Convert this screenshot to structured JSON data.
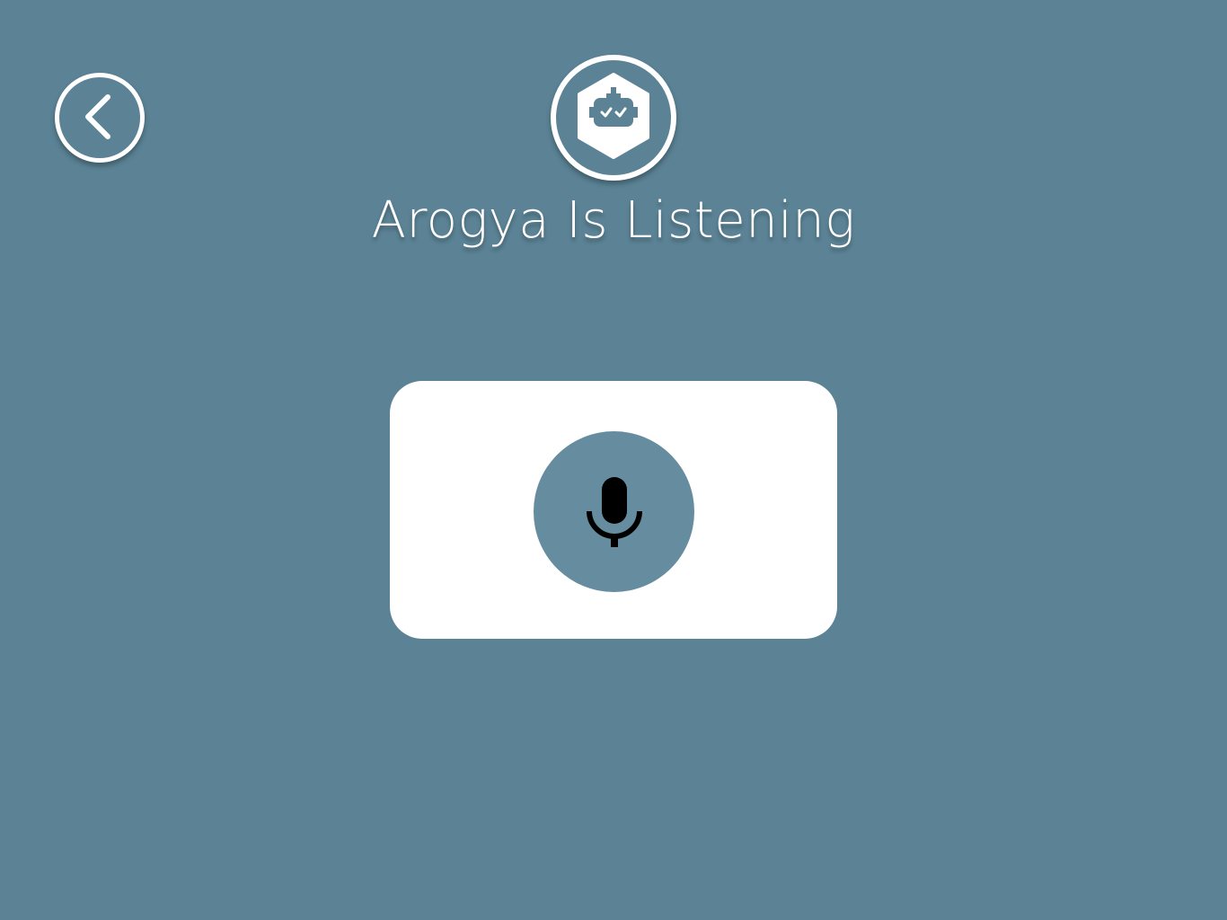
{
  "header": {
    "title": "Arogya Is Listening",
    "back_icon": "chevron-left-icon",
    "logo_icon": "robot-hexagon-icon"
  },
  "voice_panel": {
    "mic_icon": "microphone-icon",
    "state": "listening"
  },
  "colors": {
    "background": "#5b8395",
    "card": "#ffffff",
    "mic_button": "#658c9f",
    "icon_dark": "#000000",
    "foreground": "#ffffff"
  }
}
